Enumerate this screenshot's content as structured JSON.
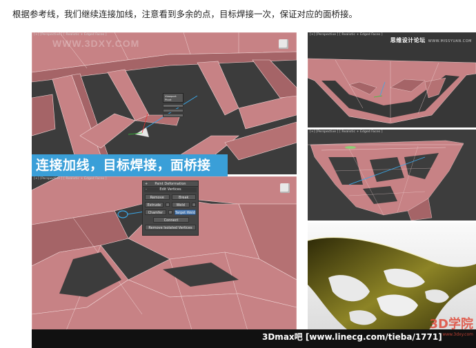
{
  "caption": "根据参考线，我们继续连接加线，注意看到多余的点，目标焊接一次，保证对应的面桥接。",
  "top_viewport": {
    "label": "[+] [Perspective ] [ Realistic + Edged Faces ]",
    "watermark": "WWW.3DXY.COM",
    "mini_menu_title": "Viewport Pivot"
  },
  "banner": "连接加线，目标焊接，面桥接",
  "bottom_viewport": {
    "label": "[+] [Perspective ] [ Realistic + Edged Faces ]"
  },
  "paint_panel": {
    "title": "Paint Deformation",
    "section": "Edit Vertices",
    "remove": "Remove",
    "break": "Break",
    "extrude": "Extrude",
    "weld": "Weld",
    "chamfer": "Chamfer",
    "target_weld": "Target Weld",
    "connect": "Connect",
    "remove_isolated": "Remove Isolated Vertices"
  },
  "right_top": {
    "label": "[+] [Perspective ] [ Realistic + Edged Faces ]",
    "forum_cn": "思维设计论坛",
    "forum_url": "WWW.MISSYUAN.COM"
  },
  "right_mid": {
    "label": "[+] [Perspective ] [ Realistic + Edged Faces ]"
  },
  "footer": {
    "text": "3Dmax吧 [www.linecg.com/tieba/1771]",
    "logo": "3D学院",
    "logo_sub": "www.3dxy.com"
  },
  "colors": {
    "mesh": "#c78285",
    "mesh_dark": "#a56467",
    "banner": "#3a9fd8",
    "viewport": "#3c3c3c",
    "render_gold": "#6f6a1a"
  }
}
